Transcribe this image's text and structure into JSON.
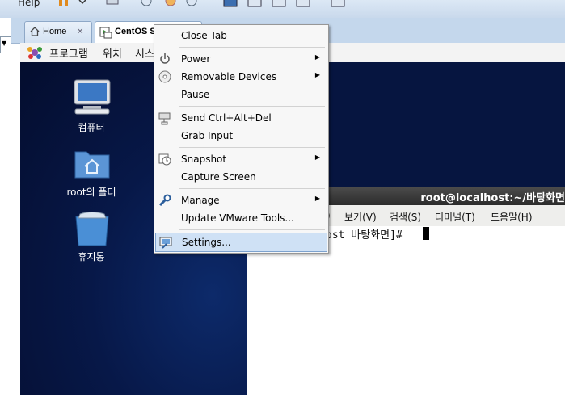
{
  "toolbar": {
    "help_label": "Help"
  },
  "tabs": [
    {
      "label": "Home"
    },
    {
      "label": "CentOS S"
    }
  ],
  "tab_close_glyph": "×",
  "gnome_panel": {
    "items": [
      "프로그램",
      "위치",
      "시스"
    ]
  },
  "desktop_icons": [
    {
      "label": "컴퓨터",
      "icon": "computer-icon"
    },
    {
      "label": "root의 폴더",
      "icon": "home-folder-icon"
    },
    {
      "label": "휴지통",
      "icon": "trash-icon"
    }
  ],
  "terminal": {
    "title": "root@localhost:~/바탕화면",
    "menu": [
      "보기(V)",
      "검색(S)",
      "터미널(T)",
      "도움말(H)"
    ],
    "menu_partial": ")",
    "prompt": "ost 바탕화면]#"
  },
  "context_menu": {
    "items": [
      {
        "label": "Close Tab"
      },
      {
        "label": "Power",
        "icon": "power-icon",
        "submenu": true
      },
      {
        "label": "Removable Devices",
        "icon": "cd-icon",
        "submenu": true
      },
      {
        "label": "Pause"
      },
      {
        "label": "Send Ctrl+Alt+Del",
        "icon": "keyboard-network-icon"
      },
      {
        "label": "Grab Input"
      },
      {
        "label": "Snapshot",
        "icon": "snapshot-icon",
        "submenu": true
      },
      {
        "label": "Capture Screen"
      },
      {
        "label": "Manage",
        "icon": "wrench-icon",
        "submenu": true
      },
      {
        "label": "Update VMware Tools..."
      },
      {
        "label": "Settings...",
        "icon": "settings-icon",
        "highlighted": true
      }
    ],
    "arrow_glyph": "▶"
  },
  "colors": {
    "menu_highlight": "#cfe1f5",
    "desktop_blue": "#071848",
    "terminal_title": "#2b2b2b"
  }
}
